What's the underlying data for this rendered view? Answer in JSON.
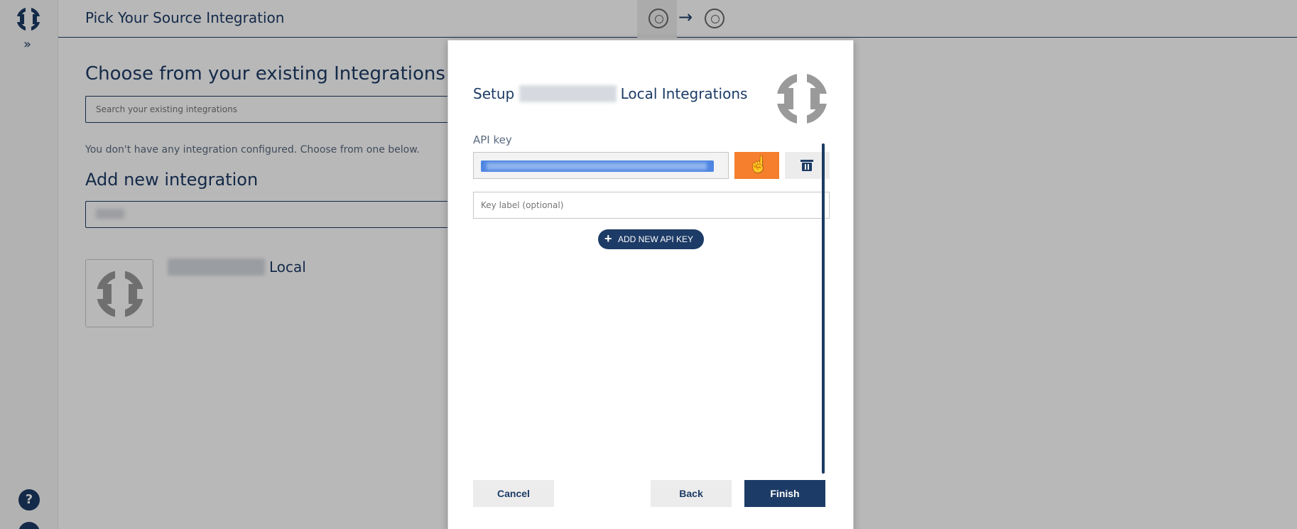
{
  "header": {
    "title": "Pick Your Source Integration",
    "step_icons": [
      "source-step-icon",
      "destination-step-icon"
    ],
    "arrow": "→"
  },
  "rail": {
    "expand_glyph": "»",
    "help_glyph": "?"
  },
  "existing": {
    "heading": "Choose from your existing Integrations",
    "search_placeholder": "Search your existing integrations",
    "empty_text": "You don't have any integration configured. Choose from one below."
  },
  "add_new": {
    "heading": "Add new integration",
    "integration_name_suffix": "Local"
  },
  "modal": {
    "title_prefix": "Setup",
    "title_suffix": "Local Integrations",
    "api_key_label": "API key",
    "key_label_placeholder": "Key label (optional)",
    "add_key_label": "ADD NEW API KEY",
    "cancel_label": "Cancel",
    "back_label": "Back",
    "finish_label": "Finish"
  },
  "colors": {
    "brand": "#1c3b66",
    "accent": "#f57f2d"
  }
}
